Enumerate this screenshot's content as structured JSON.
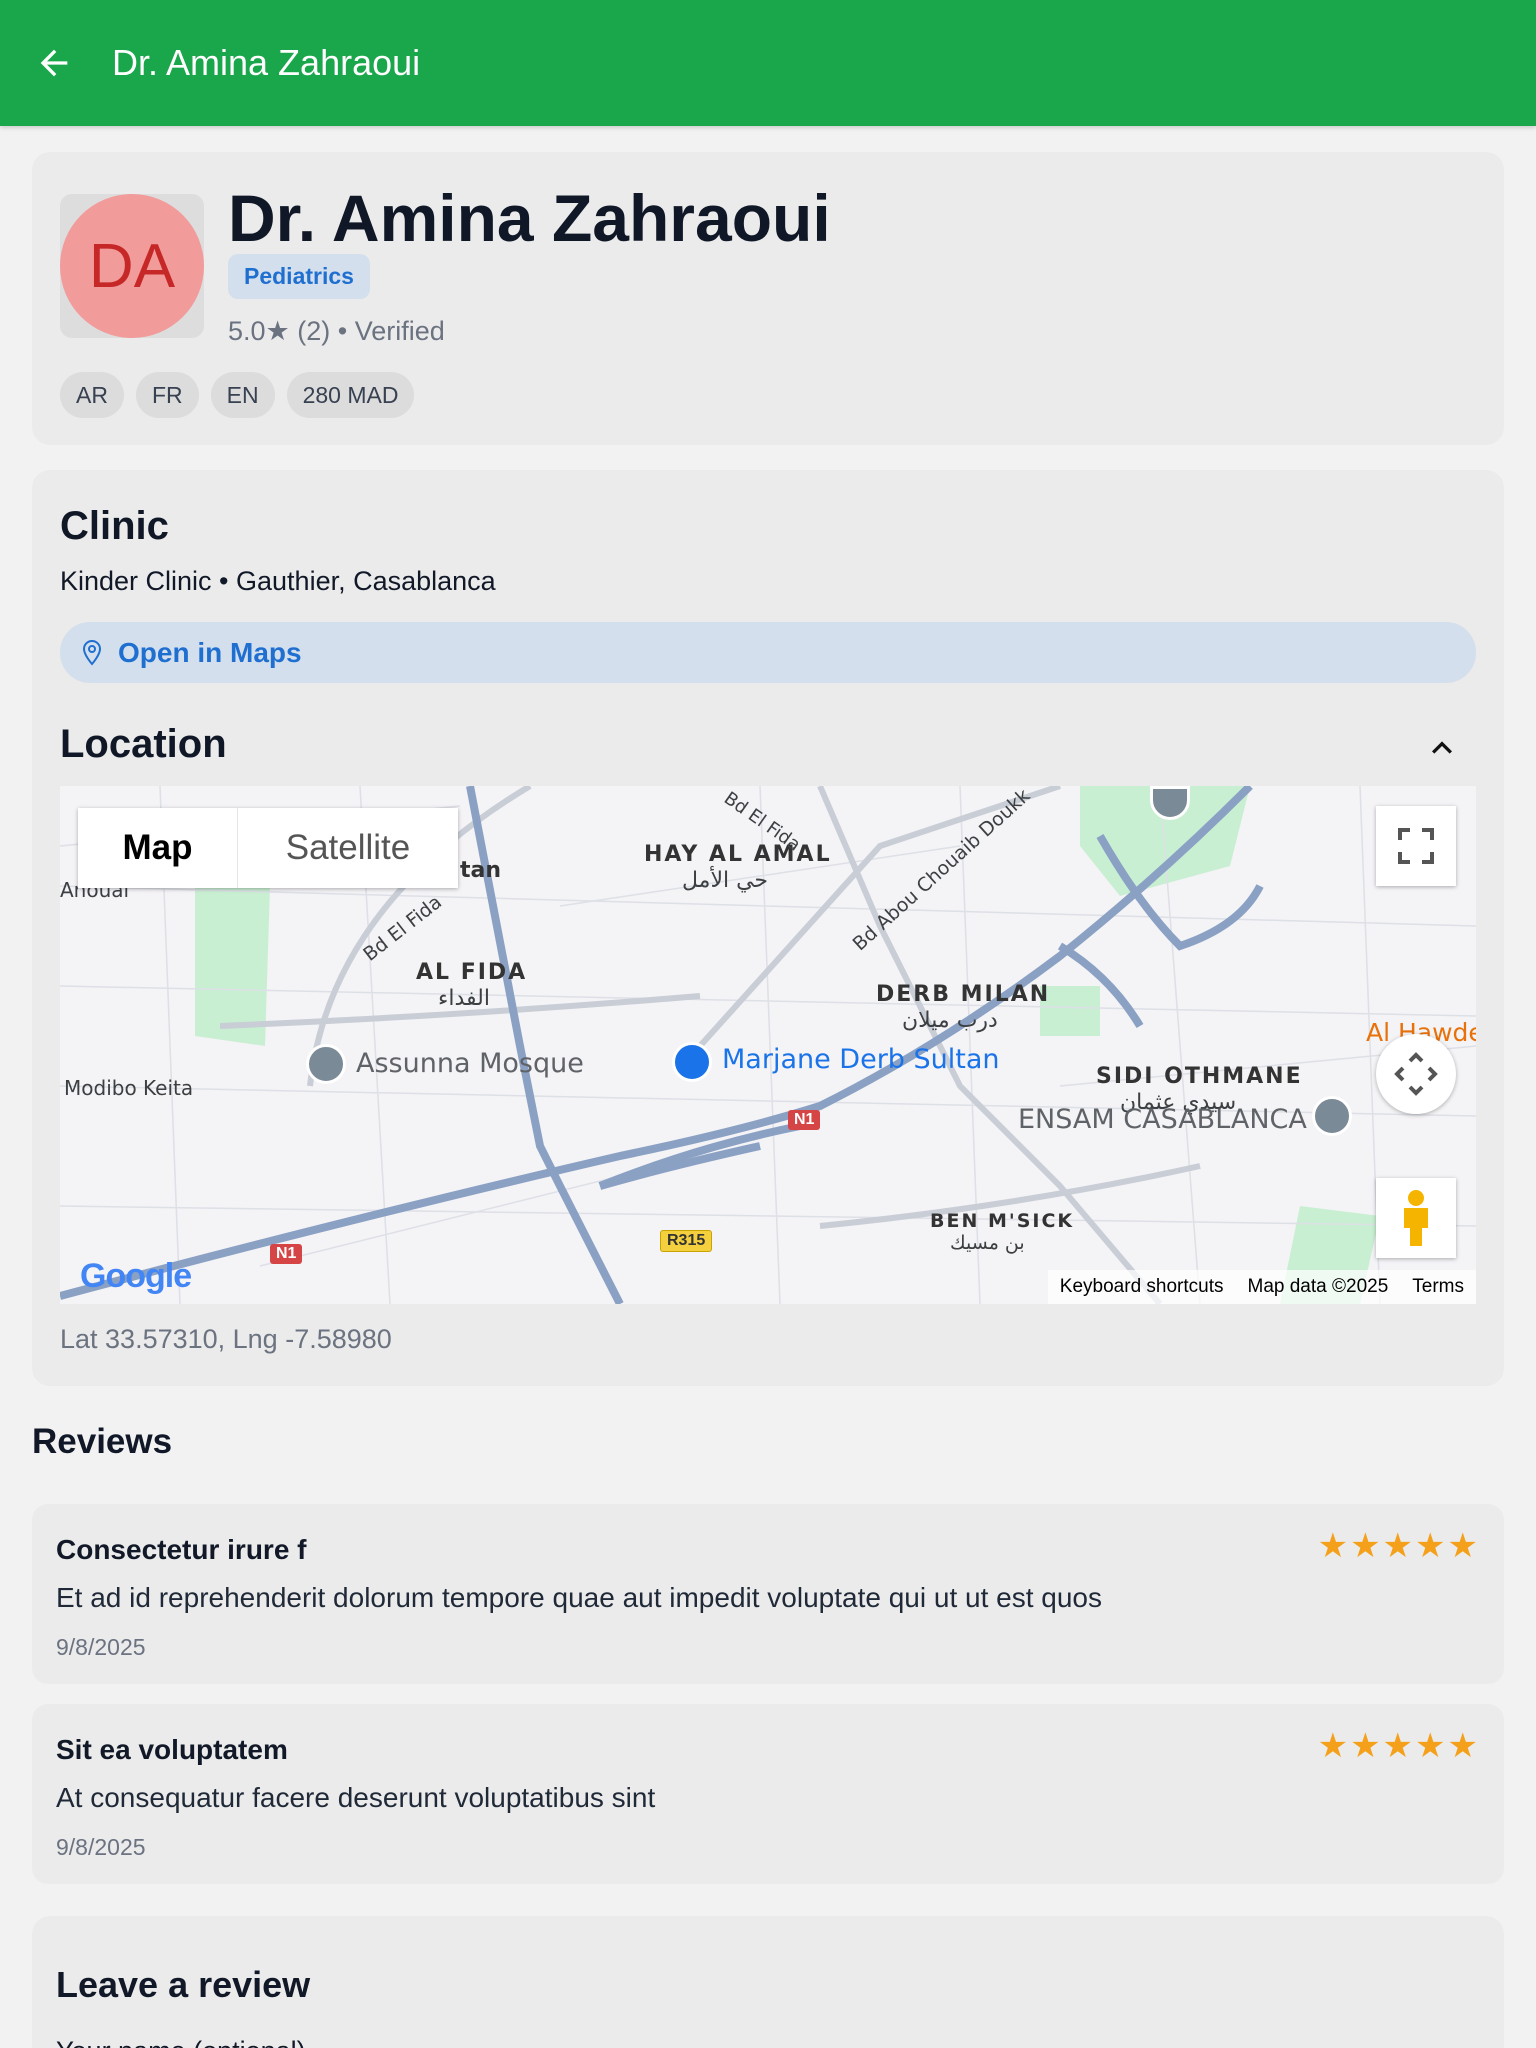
{
  "appbar": {
    "title": "Dr. Amina Zahraoui"
  },
  "profile": {
    "initials": "DA",
    "name": "Dr. Amina Zahraoui",
    "specialty": "Pediatrics",
    "rating_line": "5.0★ (2) • Verified",
    "chips": [
      "AR",
      "FR",
      "EN",
      "280 MAD"
    ]
  },
  "clinic": {
    "heading": "Clinic",
    "address": "Kinder Clinic • Gauthier, Casablanca",
    "open_maps_label": "Open in Maps"
  },
  "location": {
    "heading": "Location",
    "map_type": {
      "map": "Map",
      "satellite": "Satellite"
    },
    "labels": {
      "hay_al_amal": "HAY AL AMAL",
      "hay_al_amal_ar": "حي الأمل",
      "al_fida": "AL FIDA",
      "al_fida_ar": "الفداء",
      "derb_milan": "DERB MILAN",
      "derb_milan_ar": "درب ميلان",
      "sidi_othmane": "SIDI OTHMANE",
      "sidi_othmane_ar": "سيدي عثمان",
      "ben_msick": "BEN M'SICK",
      "ben_msick_ar": "بن مسيك",
      "assunna": "Assunna Mosque",
      "marjane": "Marjane Derb Sultan",
      "ensam": "ENSAM CASABLANCA",
      "modibo": "Modibo Keita",
      "anoual": "Anoual",
      "tan": "tan",
      "bd_el_fida": "Bd El Fida",
      "bd_el_fida_top": "Bd El Fida",
      "bd_abou": "Bd Abou Chouaib Doukk",
      "al_hawde": "Al Hawde",
      "n1": "N1",
      "n1b": "N1",
      "r315": "R315"
    },
    "footer": {
      "shortcuts": "Keyboard shortcuts",
      "data": "Map data ©2025",
      "terms": "Terms"
    },
    "google": "Google",
    "coords": "Lat 33.57310, Lng -7.58980"
  },
  "reviews": {
    "heading": "Reviews",
    "items": [
      {
        "title": "Consectetur irure f",
        "stars": "★★★★★",
        "body": "Et ad id reprehenderit dolorum tempore quae aut impedit voluptate qui ut ut est quos",
        "date": "9/8/2025"
      },
      {
        "title": "Sit ea voluptatem",
        "stars": "★★★★★",
        "body": "At consequatur facere deserunt voluptatibus sint",
        "date": "9/8/2025"
      }
    ]
  },
  "leave_review": {
    "heading": "Leave a review",
    "name_label": "Your name (optional)"
  },
  "colors": {
    "appbar": "#1aa64b",
    "accent": "#1f6fd1",
    "star": "#f4a01a",
    "avatar": "#f29b9b"
  }
}
